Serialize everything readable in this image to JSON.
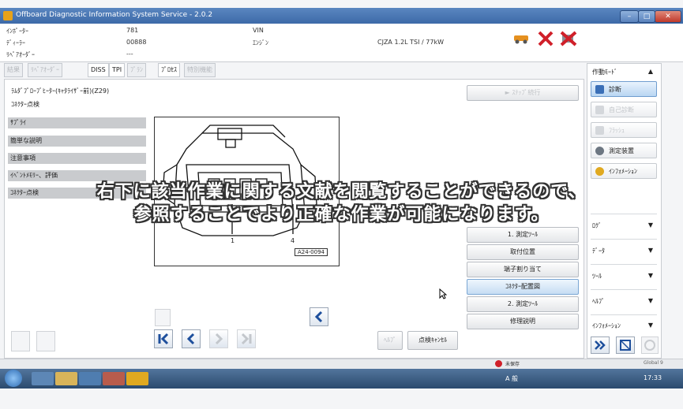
{
  "window": {
    "title": "Offboard Diagnostic Information System Service - 2.0.2",
    "controls": [
      "–",
      "□",
      "✕"
    ]
  },
  "info": {
    "importer_label": "ｲﾝﾎﾟｰﾀｰ",
    "importer_value": "781",
    "dealer_label": "ﾃﾞｨｰﾗｰ",
    "dealer_value": "00888",
    "repair_order_label": "ﾘﾍﾟｱｵｰﾀﾞｰ",
    "repair_order_value": "---",
    "vin_label": "VIN",
    "vin_value": "",
    "engine_label": "ｴﾝｼﾞﾝ",
    "engine_value": "CJZA 1.2L TSI / 77kW"
  },
  "tabs": [
    {
      "label": "結果",
      "active": false
    },
    {
      "label": "ﾘﾍﾟｱｵｰﾀﾞｰ",
      "active": false
    },
    {
      "label": "DISS",
      "active": true
    },
    {
      "label": "TPI",
      "active": true
    },
    {
      "label": "ﾌﾟﾗﾝ",
      "active": false
    },
    {
      "label": "ﾌﾟﾛｾｽ",
      "active": true
    },
    {
      "label": "特別機能",
      "active": false
    }
  ],
  "main": {
    "heading": "ﾗﾑﾀﾞﾌﾟﾛｰﾌﾞﾋｰﾀｰ(ｷｬﾀﾗｲｻﾞｰ前)(Z29)",
    "subheading": "ｺﾈｸﾀｰ点検",
    "categories": [
      "ｻﾌﾟﾗｲ",
      "簡単な説明",
      "注意事項",
      "ｲﾍﾞﾝﾄﾒﾓﾘｰ、評価",
      "ｺﾈｸﾀｰ点検"
    ],
    "diagram": {
      "pin1": "1",
      "pin4": "4",
      "ref": "A24-0094"
    },
    "next_step_label": "► ｽﾃｯﾌﾟ続行",
    "right_buttons": [
      "1. 測定ﾂｰﾙ",
      "取付位置",
      "端子割り当て",
      "ｺﾈｸﾀｰ配置図",
      "2. 測定ﾂｰﾙ",
      "修理説明"
    ],
    "selected_right_button": "ｺﾈｸﾀｰ配置図",
    "help_label": "ﾍﾙﾌﾟ",
    "cancel_label": "点検ｷｬﾝｾﾙ"
  },
  "sidebar": {
    "mode_label": "作動ﾓｰﾄﾞ",
    "buttons": [
      {
        "label": "診断",
        "icon": "stethoscope-icon",
        "state": "active"
      },
      {
        "label": "自己診断",
        "icon": "car-icon",
        "state": "disabled"
      },
      {
        "label": "ﾌﾗｯｼｭ",
        "icon": "flash-icon",
        "state": "disabled"
      },
      {
        "label": "測定装置",
        "icon": "gauge-icon",
        "state": "normal"
      },
      {
        "label": "ｲﾝﾌｫﾒｰｼｮﾝ",
        "icon": "info-icon",
        "state": "normal"
      }
    ],
    "sections": [
      "ﾛｸﾞ",
      "ﾃﾞｰﾀ",
      "ﾂｰﾙ",
      "ﾍﾙﾌﾟ",
      "ｲﾝﾌｫﾒｰｼｮﾝ"
    ]
  },
  "status": {
    "text": "未保存",
    "zoom": "Global 9"
  },
  "taskbar": {
    "clock": "17:33",
    "lang": "A 般 "
  },
  "caption": {
    "line1": "右下に該当作業に関する文献を閲覧することができるので、",
    "line2": "参照することでより正確な作業が可能になります。"
  },
  "colors": {
    "titlebar": "#3d6aa8",
    "accent_blue": "#1e4f9c",
    "alert_red": "#d0202a"
  }
}
